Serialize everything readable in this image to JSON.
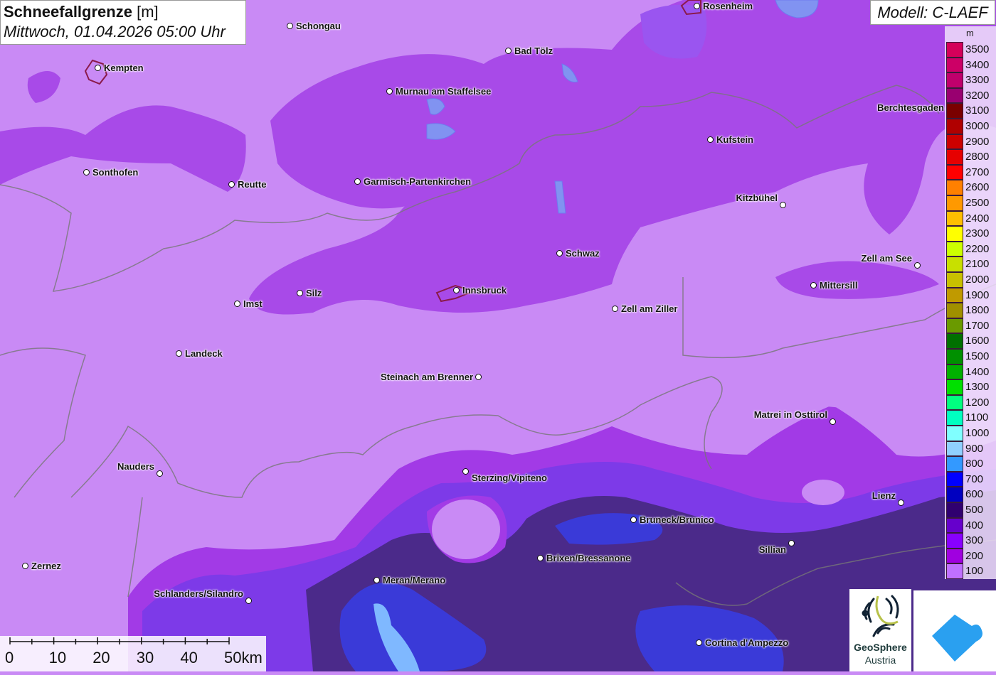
{
  "title": {
    "parameter": "Schneefallgrenze",
    "unit": "[m]",
    "datetime": "Mittwoch, 01.04.2026 05:00 Uhr"
  },
  "model": "Modell: C-LAEF",
  "legend": {
    "unit": "m",
    "entries": [
      {
        "value": "3500",
        "color": "#d4005a"
      },
      {
        "value": "3400",
        "color": "#cc0066"
      },
      {
        "value": "3300",
        "color": "#c0006c"
      },
      {
        "value": "3200",
        "color": "#990070"
      },
      {
        "value": "3100",
        "color": "#7a0000"
      },
      {
        "value": "3000",
        "color": "#b00000"
      },
      {
        "value": "2900",
        "color": "#cc0000"
      },
      {
        "value": "2800",
        "color": "#e60000"
      },
      {
        "value": "2700",
        "color": "#ff0000"
      },
      {
        "value": "2600",
        "color": "#ff8000"
      },
      {
        "value": "2500",
        "color": "#ff9900"
      },
      {
        "value": "2400",
        "color": "#ffbf00"
      },
      {
        "value": "2300",
        "color": "#ffff00"
      },
      {
        "value": "2200",
        "color": "#ccff00"
      },
      {
        "value": "2100",
        "color": "#c8e000"
      },
      {
        "value": "2000",
        "color": "#c8c000"
      },
      {
        "value": "1900",
        "color": "#c09a00"
      },
      {
        "value": "1800",
        "color": "#a09000"
      },
      {
        "value": "1700",
        "color": "#6a9a00"
      },
      {
        "value": "1600",
        "color": "#007000"
      },
      {
        "value": "1500",
        "color": "#009000"
      },
      {
        "value": "1400",
        "color": "#00b000"
      },
      {
        "value": "1300",
        "color": "#00e000"
      },
      {
        "value": "1200",
        "color": "#00ff80"
      },
      {
        "value": "1100",
        "color": "#00ffc0"
      },
      {
        "value": "1000",
        "color": "#80ffff"
      },
      {
        "value": "900",
        "color": "#90d0ff"
      },
      {
        "value": "800",
        "color": "#3399ff"
      },
      {
        "value": "700",
        "color": "#0000ff"
      },
      {
        "value": "600",
        "color": "#0000c0"
      },
      {
        "value": "500",
        "color": "#300070"
      },
      {
        "value": "400",
        "color": "#6600cc"
      },
      {
        "value": "300",
        "color": "#8800ff"
      },
      {
        "value": "200",
        "color": "#a000e0"
      },
      {
        "value": "100",
        "color": "#c070ff"
      }
    ]
  },
  "cities": [
    "Rosenheim",
    "Schongau",
    "Bad Tölz",
    "Kempten",
    "Murnau am Staffelsee",
    "Berchtesgaden",
    "Kufstein",
    "Sonthofen",
    "Reutte",
    "Garmisch-Partenkirchen",
    "Kitzbühel",
    "Schwaz",
    "Zell am See",
    "Mittersill",
    "Silz",
    "Innsbruck",
    "Imst",
    "Zell am Ziller",
    "Landeck",
    "Steinach am Brenner",
    "Matrei in Osttirol",
    "Nauders",
    "Sterzing/Vipiteno",
    "Lienz",
    "Bruneck/Brunico",
    "Sillian",
    "Brixen/Bressanone",
    "Zernez",
    "Meran/Merano",
    "Schlanders/Silandro",
    "Cortina d'Ampezzo"
  ],
  "scale": {
    "labels": [
      "0",
      "10",
      "20",
      "30",
      "40",
      "50km"
    ]
  },
  "logos": {
    "geosphere_line1": "GeoSphere",
    "geosphere_line2": "Austria"
  }
}
